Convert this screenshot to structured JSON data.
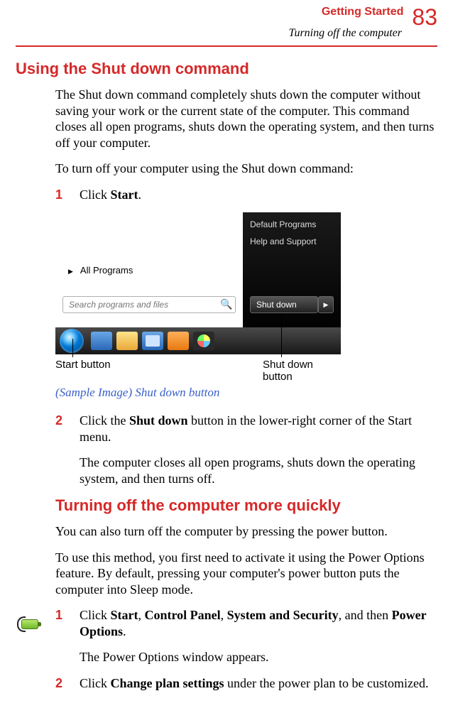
{
  "header": {
    "chapter": "Getting Started",
    "subtitle": "Turning off the computer",
    "page": "83"
  },
  "section1": {
    "title": "Using the Shut down command",
    "p1": "The Shut down command completely shuts down the computer without saving your work or the current state of the computer. This command closes all open programs, shuts down the operating system, and then turns off your computer.",
    "p2": "To turn off your computer using the Shut down command:",
    "step1_num": "1",
    "step1_a": "Click ",
    "step1_b": "Start",
    "step1_c": ".",
    "step2_num": "2",
    "step2_a": "Click the ",
    "step2_b": "Shut down",
    "step2_c": " button in the lower-right corner of the Start menu.",
    "step2_after": "The computer closes all open programs, shuts down the operating system, and then turns off."
  },
  "screenshot": {
    "right_link1": "Default Programs",
    "right_link2": "Help and Support",
    "all_programs": "All Programs",
    "search_placeholder": "Search programs and files",
    "shutdown_label": "Shut down",
    "ptr_left": "Start button",
    "ptr_right": "Shut down button",
    "caption": "(Sample Image) Shut down button"
  },
  "section2": {
    "title": "Turning off the computer more quickly",
    "p1": "You can also turn off the computer by pressing the power button.",
    "p2": "To use this method, you first need to activate it using the Power Options feature. By default, pressing your computer's power button puts the computer into Sleep mode.",
    "step1_num": "1",
    "step1_a": "Click ",
    "step1_b": "Start",
    "step1_c": ", ",
    "step1_d": "Control Panel",
    "step1_e": ", ",
    "step1_f": "System and Security",
    "step1_g": ", and then ",
    "step1_h": "Power Options",
    "step1_i": ".",
    "step1_after": "The Power Options window appears.",
    "step2_num": "2",
    "step2_a": "Click ",
    "step2_b": "Change plan settings",
    "step2_c": " under the power plan to be customized."
  }
}
